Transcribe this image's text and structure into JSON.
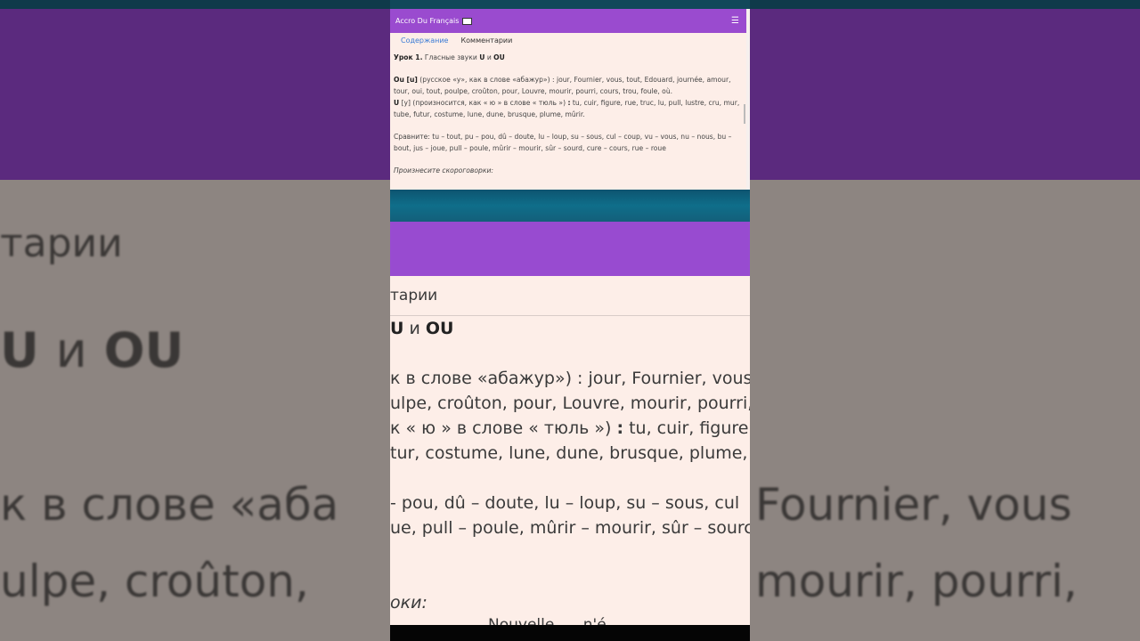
{
  "app": {
    "title": "Accro Du Français",
    "menu_icon": "hamburger-menu-icon"
  },
  "tabs": [
    {
      "label": "Содержание",
      "active": true
    },
    {
      "label": "Комментарии",
      "active": false
    }
  ],
  "lesson": {
    "heading_prefix": "Урок 1.",
    "heading_text": "Гласные звуки",
    "heading_u": "U",
    "heading_and": "и",
    "heading_ou": "OU",
    "ou_label": "Ou [u]",
    "ou_text": "(русское «у», как в слове «абажур») : jour, Fournier, vous, tout, Edouard, journée, amour, tour, oui, tout, poulpe, croûton, pour, Louvre, mourir, pourri, cours, trou, foule, où.",
    "u_label": "U",
    "u_text": "[у] (произносится, как « ю » в слове « тюль »)",
    "u_colon": ":",
    "u_words": "tu, cuir, figure, rue, truc, lu, pull, lustre, cru, mur, tube, futur, costume, lune, dune, brusque, plume, mûrir.",
    "compare": "Сравните: tu – tout, pu – pou, dû – doute, lu – loup, su – sous, cul – coup, vu – vous, nu – nous, bu – bout, jus – joue, pull – poule, mûrir – mourir, sûr – sourd, cure – cours, rue – roue",
    "tongue_twisters": "Произнесите скороговорки:"
  },
  "zoom": {
    "comments": "тарии",
    "title_u": "U",
    "title_and": "и",
    "title_ou": "OU",
    "line1": "к в слове «абажур») : jour, Fournier, vous",
    "line2": "ulpe, croûton, pour, Louvre, mourir, pourri,",
    "line3_pre": "к « ю » в слове « тюль »)",
    "line3_colon": ":",
    "line3_post": "tu, cuir, figure,",
    "line4": "tur, costume, lune, dune, brusque, plume, r",
    "line5": "- pou, dû – doute, lu – loup, su – sous, cul",
    "line6": "ue, pull – poule, mûrir – mourir, sûr – sourc",
    "line7": "оки:",
    "bottom": "Nouvelle, ... n'é..."
  },
  "background": {
    "comments": "тарии",
    "title_u": "U",
    "title_and": "и",
    "title_ou": "OU",
    "line_left_1": "к в слове «аба",
    "line_left_2": "ulpe, croûton,",
    "line_right_1": "Fournier, vous",
    "line_right_2": "mourir, pourri,"
  },
  "colors": {
    "appbar": "#9a4bcf",
    "content_bg": "#fdeee8",
    "tab_active": "#3a7bd5",
    "teal_band": "#0f6e8a"
  }
}
